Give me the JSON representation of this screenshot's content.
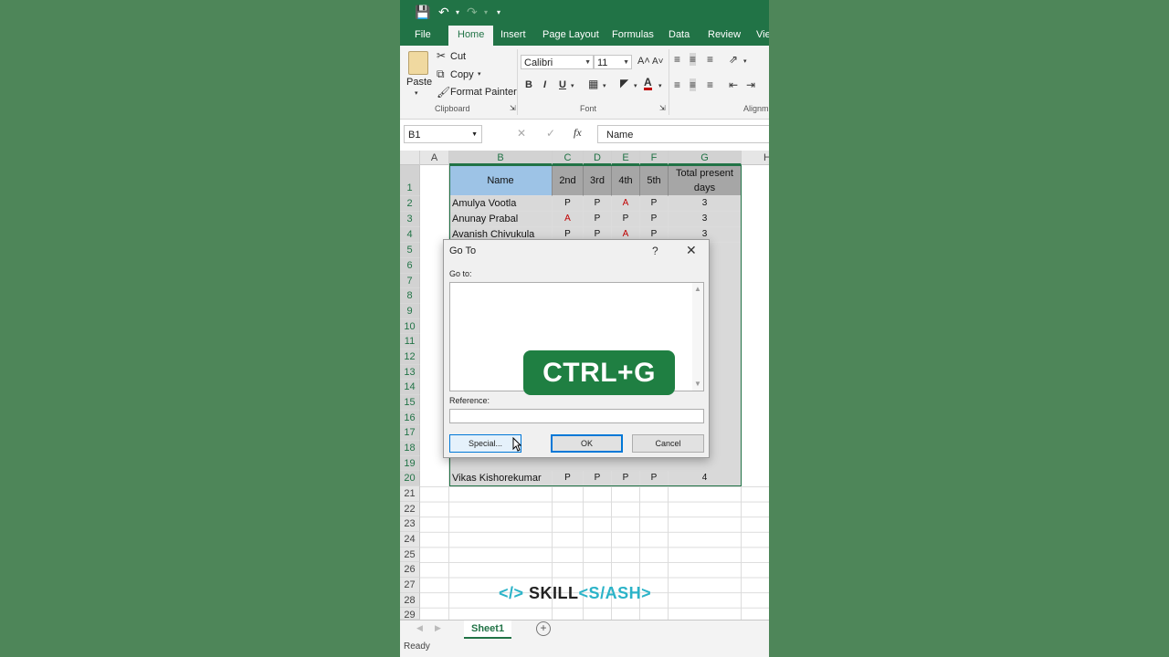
{
  "qat": {
    "save_icon": "save-icon",
    "undo_icon": "undo-icon",
    "redo_icon": "redo-icon",
    "customize_icon": "customize-icon"
  },
  "tabs": [
    {
      "label": "File"
    },
    {
      "label": "Home",
      "active": true
    },
    {
      "label": "Insert"
    },
    {
      "label": "Page Layout"
    },
    {
      "label": "Formulas"
    },
    {
      "label": "Data"
    },
    {
      "label": "Review"
    },
    {
      "label": "Vie"
    }
  ],
  "ribbon": {
    "paste": "Paste",
    "cut": "Cut",
    "copy": "Copy",
    "format_painter": "Format Painter",
    "clipboard_label": "Clipboard",
    "font_name": "Calibri",
    "font_size": "11",
    "font_label": "Font",
    "alignment_label": "Alignm",
    "bold": "B",
    "italic": "I",
    "underline": "U"
  },
  "formula_bar": {
    "name_box": "B1",
    "fx": "fx",
    "cancel": "✕",
    "enter": "✓",
    "content": "Name"
  },
  "columns": [
    "A",
    "B",
    "C",
    "D",
    "E",
    "F",
    "G",
    "H"
  ],
  "header": {
    "name": "Name",
    "d2": "2nd",
    "d3": "3rd",
    "d4": "4th",
    "d5": "5th",
    "total": "Total present days"
  },
  "rows": [
    {
      "name": "Amulya Vootla",
      "d2": "P",
      "d3": "P",
      "d4": "A",
      "d5": "P",
      "total": "3"
    },
    {
      "name": "Anunay Prabal",
      "d2": "A",
      "d3": "P",
      "d4": "P",
      "d5": "P",
      "total": "3"
    },
    {
      "name": "Avanish Chivukula",
      "d2": "P",
      "d3": "P",
      "d4": "A",
      "d5": "P",
      "total": "3"
    }
  ],
  "last_row": {
    "name": "Vikas Kishorekumar",
    "d2": "P",
    "d3": "P",
    "d4": "P",
    "d5": "P",
    "total": "4"
  },
  "row_numbers": [
    "1",
    "2",
    "3",
    "4",
    "5",
    "6",
    "7",
    "8",
    "9",
    "10",
    "11",
    "12",
    "13",
    "14",
    "15",
    "16",
    "17",
    "18",
    "19",
    "20",
    "21",
    "22",
    "23",
    "24",
    "25",
    "26",
    "27",
    "28",
    "29"
  ],
  "dialog": {
    "title": "Go To",
    "help": "?",
    "close": "✕",
    "goto_label": "Go to:",
    "reference_label": "Reference:",
    "reference_value": "",
    "special_button": "Special...",
    "ok_button": "OK",
    "cancel_button": "Cancel"
  },
  "overlay": {
    "text": "CTRL+G"
  },
  "sheet": {
    "tab": "Sheet1",
    "add": "+"
  },
  "status": {
    "text": "Ready"
  },
  "branding": {
    "logo_mark": "</>",
    "logo_text_1": "SKILL",
    "logo_text_2": "<S/ASH>"
  },
  "colors": {
    "excel_green": "#217346",
    "background": "#4e8659",
    "absent_red": "#c00000",
    "header_blue": "#9dc3e6",
    "header_gray": "#a6a6a6"
  }
}
